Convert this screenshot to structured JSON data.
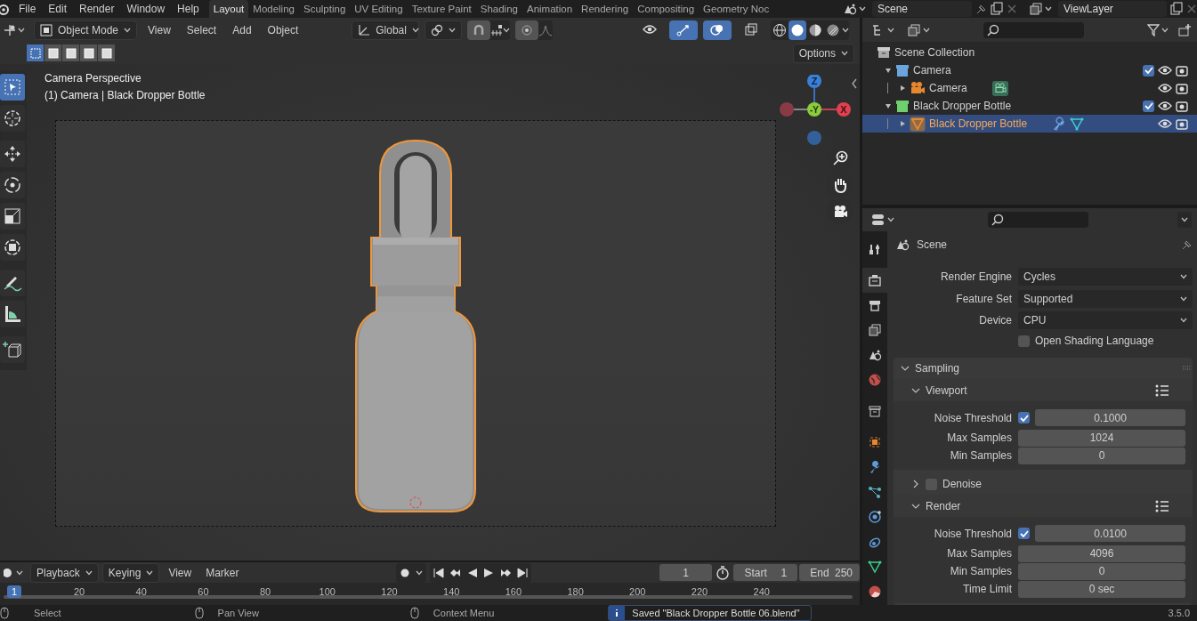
{
  "menu": [
    "File",
    "Edit",
    "Render",
    "Window",
    "Help"
  ],
  "workspaces": [
    {
      "label": "Layout",
      "selected": true
    },
    {
      "label": "Modeling",
      "selected": false
    },
    {
      "label": "Sculpting",
      "selected": false
    },
    {
      "label": "UV Editing",
      "selected": false
    },
    {
      "label": "Texture Paint",
      "selected": false
    },
    {
      "label": "Shading",
      "selected": false
    },
    {
      "label": "Animation",
      "selected": false
    },
    {
      "label": "Rendering",
      "selected": false
    },
    {
      "label": "Compositing",
      "selected": false
    },
    {
      "label": "Geometry Noc",
      "selected": false
    }
  ],
  "scene": "Scene",
  "view_layer": "ViewLayer",
  "viewport": {
    "mode": "Object Mode",
    "menus": [
      "View",
      "Select",
      "Add",
      "Object"
    ],
    "orientation": "Global",
    "toggles": [
      {
        "kind": "visibility",
        "on": false
      },
      {
        "kind": "gizmo",
        "on": true
      },
      {
        "kind": "overlay",
        "on": true
      },
      {
        "kind": "xray",
        "on": false
      }
    ],
    "shading": [
      {
        "kind": "wireframe",
        "selected": false
      },
      {
        "kind": "solid",
        "selected": true
      },
      {
        "kind": "material",
        "selected": false
      },
      {
        "kind": "rendered",
        "selected": false
      }
    ],
    "select_modes": [
      {
        "selected": true
      },
      {
        "selected": false
      },
      {
        "selected": false
      },
      {
        "selected": false
      },
      {
        "selected": false
      }
    ],
    "options": "Options",
    "title": "Camera Perspective",
    "subtitle": "(1) Camera | Black Dropper Bottle",
    "tools": [
      {
        "kind": "select",
        "selected": true
      },
      {
        "kind": "cursor",
        "selected": false
      },
      {
        "kind": "move",
        "selected": false
      },
      {
        "kind": "rotate",
        "selected": false
      },
      {
        "kind": "scale",
        "selected": false
      },
      {
        "kind": "transform",
        "selected": false
      },
      {
        "kind": "annotate",
        "selected": false
      },
      {
        "kind": "measure",
        "selected": false
      },
      {
        "kind": "add-cube",
        "selected": false
      }
    ],
    "gizmo": {
      "z": "Z",
      "y": "-Y",
      "x": "X"
    }
  },
  "outliner": {
    "root": "Scene Collection",
    "items": [
      {
        "label": "Camera",
        "kind": "collection",
        "color": "#6aa6dc",
        "expanded": true,
        "checked": true,
        "selected": false,
        "children": [
          {
            "label": "Camera",
            "kind": "camera",
            "expanded": false,
            "selected": false
          }
        ]
      },
      {
        "label": "Black Dropper Bottle",
        "kind": "collection",
        "color": "#6fcf6f",
        "expanded": true,
        "checked": true,
        "selected": false,
        "children": [
          {
            "label": "Black Dropper Bottle",
            "kind": "mesh",
            "expanded": false,
            "selected": true
          }
        ]
      }
    ]
  },
  "properties": {
    "tabs": [
      {
        "kind": "tool",
        "selected": false
      },
      {
        "kind": "render",
        "selected": true
      },
      {
        "kind": "output",
        "selected": false
      },
      {
        "kind": "view-layer",
        "selected": false
      },
      {
        "kind": "scene",
        "selected": false
      },
      {
        "kind": "world",
        "selected": false
      },
      {
        "kind": "collection",
        "selected": false
      },
      {
        "kind": "object",
        "selected": false
      },
      {
        "kind": "modifiers",
        "selected": false
      },
      {
        "kind": "particles",
        "selected": false
      },
      {
        "kind": "physics",
        "selected": false
      },
      {
        "kind": "constraints",
        "selected": false
      },
      {
        "kind": "data",
        "selected": false
      },
      {
        "kind": "material",
        "selected": false
      }
    ],
    "title": "Scene",
    "fields": [
      {
        "label": "Render Engine",
        "value": "Cycles"
      },
      {
        "label": "Feature Set",
        "value": "Supported"
      },
      {
        "label": "Device",
        "value": "CPU"
      }
    ],
    "osl": {
      "label": "Open Shading Language",
      "checked": false
    },
    "sampling": {
      "title": "Sampling",
      "expanded": true,
      "subpanels": [
        {
          "title": "Viewport",
          "expanded": true,
          "rows": [
            {
              "label": "Noise Threshold",
              "checked": true,
              "value": "0.1000"
            },
            {
              "label": "Max Samples",
              "value": "1024"
            },
            {
              "label": "Min Samples",
              "value": "0"
            }
          ]
        },
        {
          "title": "Denoise",
          "expanded": false,
          "checked": false
        },
        {
          "title": "Render",
          "expanded": true,
          "rows": [
            {
              "label": "Noise Threshold",
              "checked": true,
              "value": "0.0100"
            },
            {
              "label": "Max Samples",
              "value": "4096"
            },
            {
              "label": "Min Samples",
              "value": "0"
            },
            {
              "label": "Time Limit",
              "value": "0 sec"
            }
          ]
        }
      ]
    }
  },
  "timeline": {
    "menus": [
      "Playback",
      "Keying",
      "View",
      "Marker"
    ],
    "current_frame": "1",
    "start_label": "Start",
    "start": "1",
    "end_label": "End",
    "end": "250",
    "playhead": "1",
    "ticks": [
      "20",
      "40",
      "60",
      "80",
      "100",
      "120",
      "140",
      "160",
      "180",
      "200",
      "220",
      "240"
    ]
  },
  "status": {
    "hints": [
      "Select",
      "Pan View",
      "Context Menu"
    ],
    "report": "Saved \"Black Dropper Bottle 06.blend\"",
    "version": "3.5.0"
  }
}
